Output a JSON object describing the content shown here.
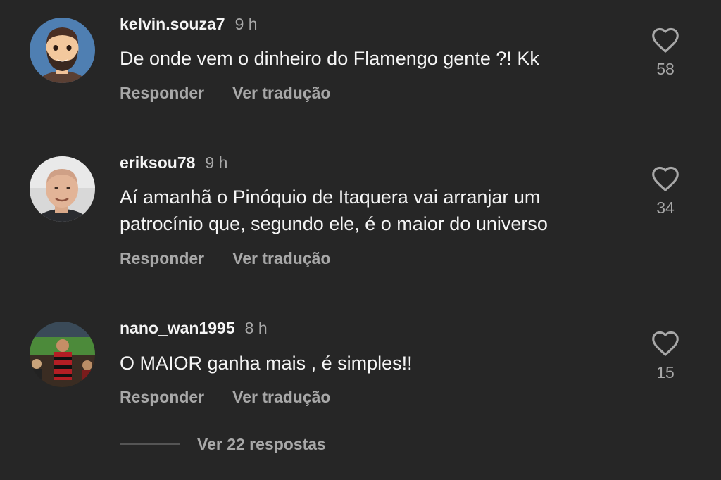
{
  "comments": [
    {
      "username": "kelvin.souza7",
      "time": "9 h",
      "text": "De onde vem o dinheiro do Flamengo gente ?! Kk",
      "reply_label": "Responder",
      "translate_label": "Ver tradução",
      "likes": "58",
      "avatar": "cartoon-bearded-man-avatar"
    },
    {
      "username": "eriksou78",
      "time": "9 h",
      "text": "Aí amanhã o Pinóquio de Itaquera vai arranjar um patrocínio que, segundo ele, é o maior do universo",
      "reply_label": "Responder",
      "translate_label": "Ver tradução",
      "likes": "34",
      "avatar": "bald-man-photo-avatar"
    },
    {
      "username": "nano_wan1995",
      "time": "8 h",
      "text": "O MAIOR ganha mais , é simples!!",
      "reply_label": "Responder",
      "translate_label": "Ver tradução",
      "likes": "15",
      "avatar": "stadium-fan-photo-avatar"
    }
  ],
  "view_replies": "Ver 22 respostas",
  "colors": {
    "background": "#262626",
    "primary_text": "#f5f5f5",
    "secondary_text": "#a8a8a8"
  }
}
